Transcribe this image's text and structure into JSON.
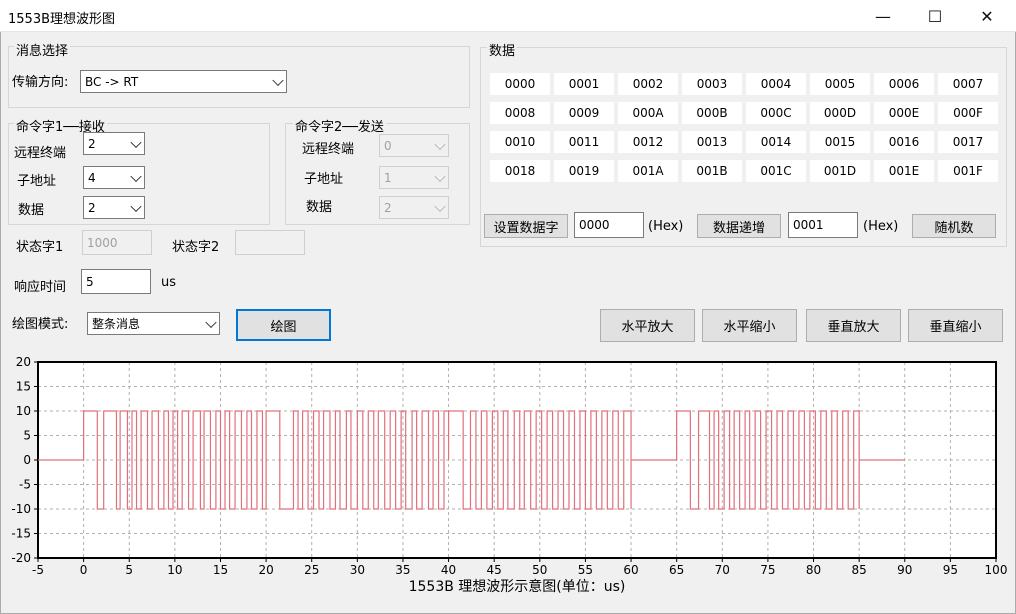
{
  "window": {
    "title": "1553B理想波形图",
    "minimize": "—",
    "maximize": "☐",
    "close": "✕"
  },
  "message_select": {
    "group_label": "消息选择",
    "direction_label": "传输方向:",
    "direction_value": "BC -> RT"
  },
  "cmd1": {
    "group_label": "命令字1──接收",
    "rt_label": "远程终端",
    "rt_value": "2",
    "sub_label": "子地址",
    "sub_value": "4",
    "data_label": "数据",
    "data_value": "2"
  },
  "cmd2": {
    "group_label": "命令字2──发送",
    "rt_label": "远程终端",
    "rt_value": "0",
    "sub_label": "子地址",
    "sub_value": "1",
    "data_label": "数据",
    "data_value": "2"
  },
  "status": {
    "s1_label": "状态字1",
    "s1_value": "1000",
    "s2_label": "状态字2",
    "s2_value": ""
  },
  "response": {
    "label": "响应时间",
    "value": "5",
    "unit": "us"
  },
  "draw": {
    "mode_label": "绘图模式:",
    "mode_value": "整条消息",
    "draw_button": "绘图"
  },
  "data_group": {
    "label": "数据",
    "cells": [
      "0000",
      "0001",
      "0002",
      "0003",
      "0004",
      "0005",
      "0006",
      "0007",
      "0008",
      "0009",
      "000A",
      "000B",
      "000C",
      "000D",
      "000E",
      "000F",
      "0010",
      "0011",
      "0012",
      "0013",
      "0014",
      "0015",
      "0016",
      "0017",
      "0018",
      "0019",
      "001A",
      "001B",
      "001C",
      "001D",
      "001E",
      "001F"
    ],
    "set_button": "设置数据字",
    "set_value": "0000",
    "hex1": "(Hex)",
    "inc_button": "数据递增",
    "inc_value": "0001",
    "hex2": "(Hex)",
    "random_button": "随机数"
  },
  "zoom": {
    "h_in": "水平放大",
    "h_out": "水平缩小",
    "v_in": "垂直放大",
    "v_out": "垂直缩小"
  },
  "colors": {
    "wave": "#e0707a",
    "focus": "#0078d7",
    "grid": "#b0b0b0"
  },
  "chart_data": {
    "type": "line",
    "xlabel": "1553B 理想波形示意图(单位：us)",
    "ylabel": "",
    "xlim": [
      -5,
      100
    ],
    "ylim": [
      -20,
      20
    ],
    "xticks": [
      -5,
      0,
      5,
      10,
      15,
      20,
      25,
      30,
      35,
      40,
      45,
      50,
      55,
      60,
      65,
      70,
      75,
      80,
      85,
      90,
      95,
      100
    ],
    "yticks": [
      20,
      15,
      10,
      5,
      0,
      -5,
      -10,
      -15,
      -20
    ],
    "grid": true,
    "series": [
      {
        "segments": [
          {
            "x0": -5,
            "x1": 0,
            "kind": "flat",
            "level": 0
          },
          {
            "x0": 0,
            "x1": 20,
            "kind": "manchester",
            "amplitude": 10,
            "transitions": [
              1.5,
              2.2,
              3.6,
              4.0,
              4.8,
              5.3,
              5.8,
              6.3,
              7.0,
              7.5,
              8.2,
              8.8,
              9.3,
              9.8,
              10.3,
              10.8,
              11.5,
              12.0,
              12.8,
              13.2,
              13.9,
              14.5,
              15.0,
              15.5,
              16.0,
              16.6,
              17.3,
              17.9,
              18.4,
              19.0,
              19.6
            ]
          },
          {
            "x0": 20,
            "x1": 40,
            "kind": "manchester",
            "amplitude": 10,
            "transitions": [
              21.5,
              23.0,
              23.5,
              24.0,
              24.6,
              25.2,
              25.8,
              26.3,
              27.0,
              27.6,
              28.1,
              28.8,
              29.3,
              30.0,
              30.6,
              31.2,
              31.8,
              32.3,
              33.0,
              33.6,
              34.2,
              34.8,
              35.3,
              36.0,
              36.5,
              37.1,
              37.8,
              38.3,
              38.9,
              39.5
            ]
          },
          {
            "x0": 40,
            "x1": 60,
            "kind": "manchester",
            "amplitude": 10,
            "transitions": [
              41.6,
              42.4,
              43.0,
              43.6,
              44.2,
              44.8,
              45.4,
              46.0,
              46.5,
              47.2,
              47.8,
              48.3,
              49.0,
              49.6,
              50.2,
              50.8,
              51.4,
              52.0,
              52.6,
              53.2,
              53.8,
              54.4,
              55.0,
              55.6,
              56.2,
              56.8,
              57.4,
              58.0,
              58.6,
              59.2,
              60.0
            ]
          },
          {
            "x0": 60,
            "x1": 65,
            "kind": "flat",
            "level": 0
          },
          {
            "x0": 65,
            "x1": 85,
            "kind": "manchester",
            "amplitude": 10,
            "transitions": [
              66.5,
              67.4,
              68.6,
              69.1,
              69.6,
              70.2,
              70.8,
              71.3,
              71.9,
              72.5,
              73.0,
              73.6,
              74.2,
              74.8,
              75.4,
              76.0,
              76.6,
              77.2,
              77.8,
              78.4,
              79.0,
              79.6,
              80.2,
              80.8,
              81.4,
              82.0,
              82.6,
              83.2,
              83.8,
              84.4,
              85.0
            ]
          },
          {
            "x0": 85,
            "x1": 90,
            "kind": "flat",
            "level": 0
          }
        ]
      }
    ]
  }
}
